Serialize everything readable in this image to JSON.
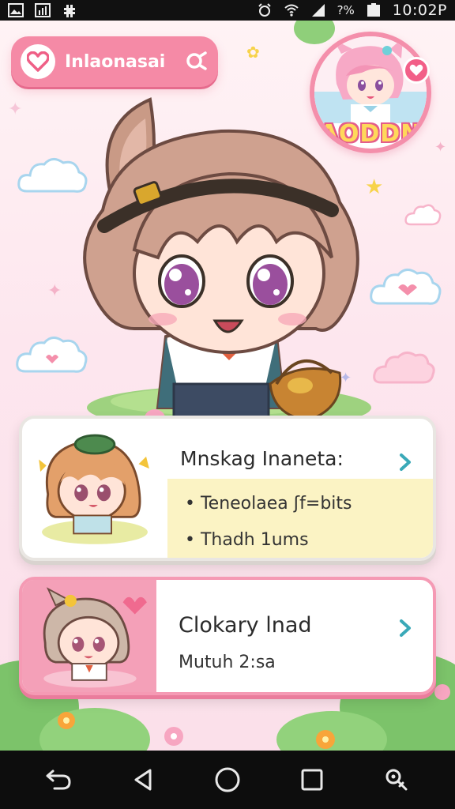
{
  "status_bar": {
    "battery_pct": "?%",
    "time": "10:02P"
  },
  "search": {
    "text": "Inlaonasai"
  },
  "badge": {
    "logo_text": "AODDN"
  },
  "cards": [
    {
      "title": "Mnskag Inaneta:",
      "items": [
        "• Teneolaea ʃf=bits",
        "• Thadh 1ums"
      ]
    },
    {
      "title": "Clokary lnad",
      "subtitle": "Mutuh 2:sa"
    }
  ],
  "colors": {
    "accent_pink": "#f58aa6",
    "card_highlight": "#fbf3c4",
    "chevron_teal": "#3aa9b8"
  },
  "icons": {
    "status_left": [
      "gallery-icon",
      "chart-icon",
      "settings-icon"
    ],
    "status_right": [
      "alarm-icon",
      "wifi-icon",
      "signal-icon",
      "battery-icon"
    ],
    "nav": [
      "back-icon",
      "home-triangle-icon",
      "home-circle-icon",
      "recents-icon",
      "assistant-icon"
    ]
  }
}
